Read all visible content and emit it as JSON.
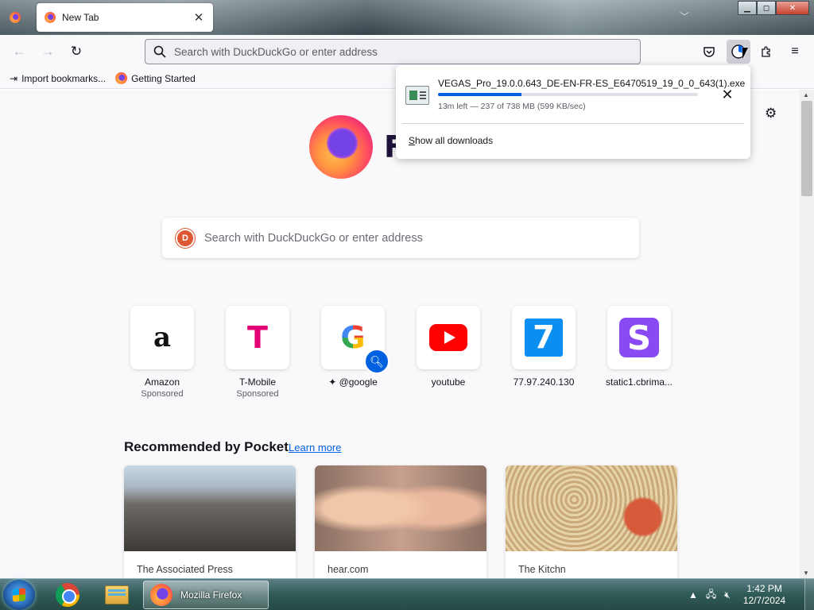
{
  "tabs": [
    {
      "title": "New Tab",
      "active": true
    }
  ],
  "window_controls": {
    "minimize": "▁",
    "maximize": "◻",
    "close": "✕"
  },
  "toolbar": {
    "back_icon": "←",
    "forward_icon": "→",
    "reload_icon": "↻",
    "url_placeholder": "Search with DuckDuckGo or enter address",
    "pocket_icon": "pocket-icon",
    "downloads_icon": "download-progress-icon",
    "extensions_icon": "puzzle-icon",
    "menu_icon": "≡"
  },
  "bookmarks": [
    {
      "label": "Import bookmarks...",
      "icon": "import-icon"
    },
    {
      "label": "Getting Started",
      "icon": "firefox-icon"
    }
  ],
  "newtab": {
    "wordmark": "F",
    "search_placeholder": "Search with DuckDuckGo or enter address",
    "top_sites": [
      {
        "title": "Amazon",
        "sub": "Sponsored",
        "logo": "a"
      },
      {
        "title": "T-Mobile",
        "sub": "Sponsored",
        "logo": "T"
      },
      {
        "title": "✦ @google",
        "sub": "",
        "logo": "G"
      },
      {
        "title": "youtube",
        "sub": "",
        "logo": ""
      },
      {
        "title": "77.97.240.130",
        "sub": "",
        "logo": "7"
      },
      {
        "title": "static1.cbrima...",
        "sub": "",
        "logo": "S"
      }
    ],
    "pocket_heading": "Recommended by Pocket",
    "pocket_learn_more": "Learn more",
    "pocket_cards": [
      {
        "source": "The Associated Press"
      },
      {
        "source": "hear.com"
      },
      {
        "source": "The Kitchn"
      }
    ]
  },
  "downloads_panel": {
    "file_name": "VEGAS_Pro_19.0.0.643_DE-EN-FR-ES_E6470519_19_0_0_643(1).exe",
    "status": "13m left — 237 of 738 MB (599 KB/sec)",
    "progress_percent": 32,
    "show_all_prefix": "S",
    "show_all_rest": "how all downloads"
  },
  "taskbar": {
    "firefox_label": "Mozilla Firefox",
    "time": "1:42 PM",
    "date": "12/7/2024"
  },
  "colors": {
    "accent": "#0061e0",
    "tmobile": "#e20074",
    "youtube": "#ff0000"
  }
}
